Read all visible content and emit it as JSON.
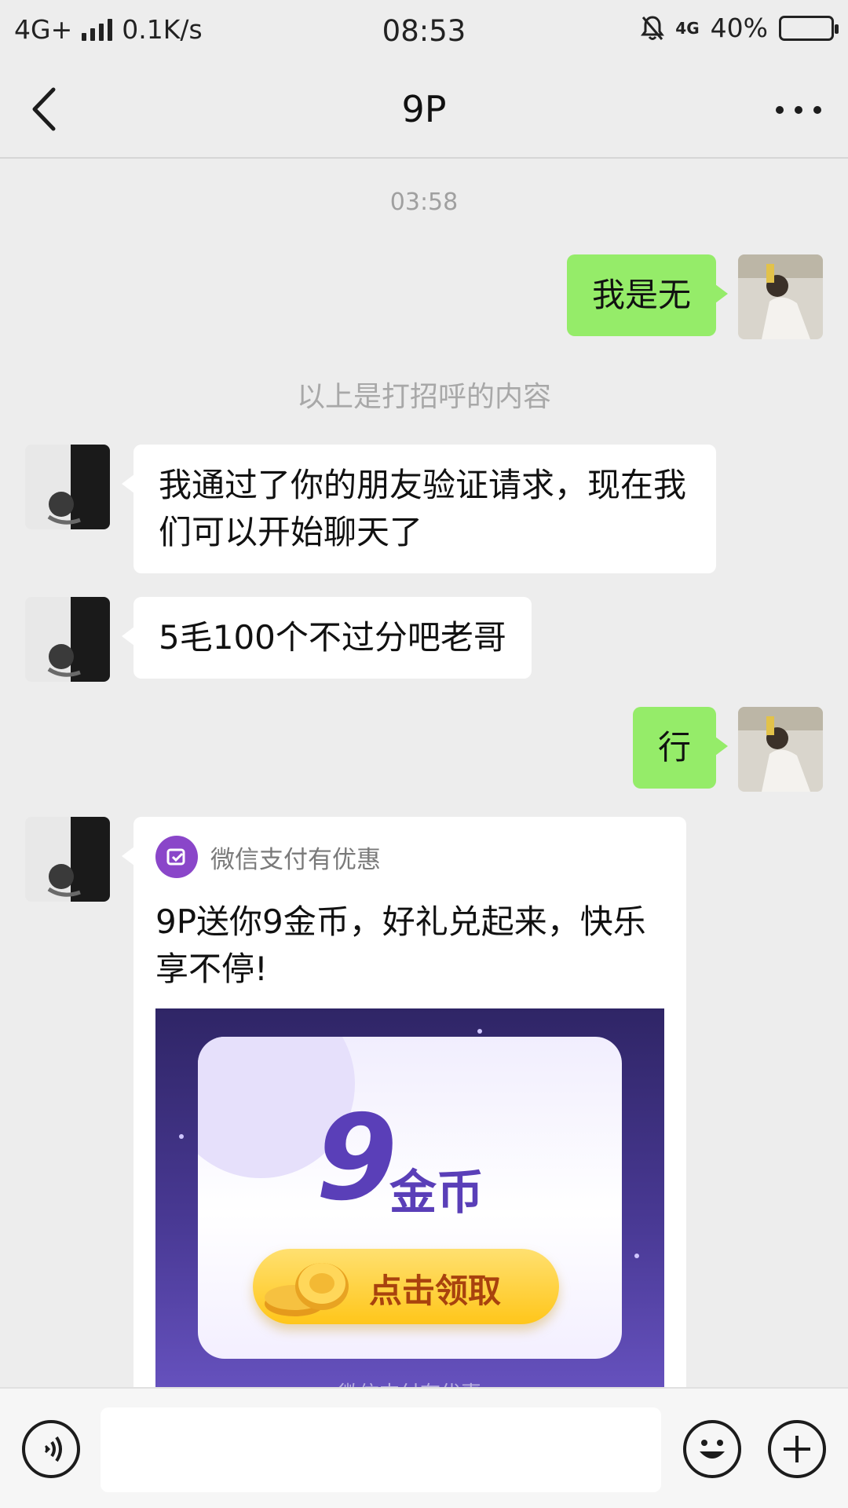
{
  "status_bar": {
    "network": "4G+",
    "speed": "0.1K/s",
    "time": "08:53",
    "net_right": "4G",
    "battery": "40%",
    "battery_level": 0.4
  },
  "nav": {
    "title": "9P"
  },
  "chat": {
    "timestamp": "03:58",
    "greeting_notice": "以上是打招呼的内容",
    "messages": [
      {
        "side": "me",
        "text": "我是无"
      },
      {
        "side": "them",
        "text": "我通过了你的朋友验证请求，现在我们可以开始聊天了"
      },
      {
        "side": "them",
        "text": "5毛100个不过分吧老哥"
      },
      {
        "side": "me",
        "text": "行"
      }
    ],
    "card": {
      "source": "微信支付有优惠",
      "title": "9P送你9金币，好礼兑起来，快乐享不停!",
      "promo_number": "9",
      "promo_unit": "金币",
      "promo_button": "点击领取",
      "promo_footer": "微信支付有优惠"
    }
  },
  "colors": {
    "me_bubble": "#95ec69",
    "them_bubble": "#ffffff",
    "background": "#ededed",
    "card_logo": "#8a46c9"
  }
}
